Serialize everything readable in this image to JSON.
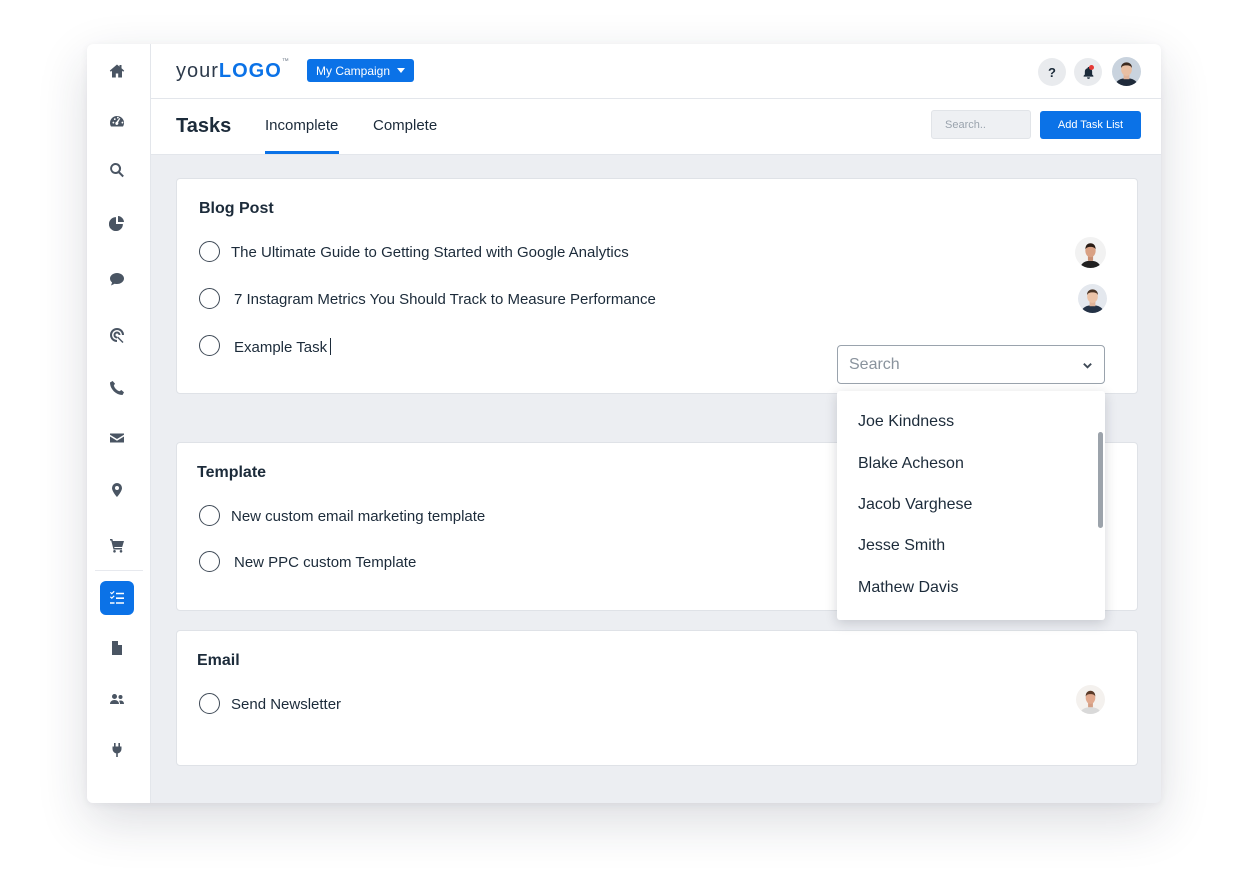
{
  "topbar": {
    "logo_prefix": "your",
    "logo_bold": "LOGO",
    "logo_tm": "™",
    "campaign_label": "My Campaign",
    "help_label": "?"
  },
  "sidebar": {
    "items": [
      {
        "icon": "home-icon"
      },
      {
        "icon": "dashboard-icon"
      },
      {
        "icon": "search-icon"
      },
      {
        "icon": "pie-chart-icon"
      },
      {
        "icon": "chat-icon"
      },
      {
        "icon": "target-icon"
      },
      {
        "icon": "phone-icon"
      },
      {
        "icon": "mail-icon"
      },
      {
        "icon": "location-icon"
      },
      {
        "icon": "cart-icon"
      },
      {
        "icon": "tasks-icon",
        "active": true
      },
      {
        "icon": "document-icon"
      },
      {
        "icon": "users-icon"
      },
      {
        "icon": "plug-icon"
      }
    ]
  },
  "page": {
    "title": "Tasks",
    "tabs": [
      {
        "label": "Incomplete",
        "active": true
      },
      {
        "label": "Complete",
        "active": false
      }
    ],
    "search_placeholder": "Search..",
    "add_button": "Add Task List"
  },
  "task_lists": [
    {
      "title": "Blog Post",
      "tasks": [
        {
          "text": "The Ultimate Guide to Getting Started with Google Analytics"
        },
        {
          "text": "7 Instagram Metrics You Should Track to Measure Performance"
        },
        {
          "text": "Example Task"
        }
      ]
    },
    {
      "title": "Template",
      "tasks": [
        {
          "text": "New custom email marketing template"
        },
        {
          "text": "New PPC custom Template"
        }
      ]
    },
    {
      "title": "Email",
      "tasks": [
        {
          "text": "Send Newsletter"
        }
      ]
    }
  ],
  "assignee_select": {
    "placeholder": "Search",
    "options": [
      "Joe Kindness",
      "Blake Acheson",
      "Jacob Varghese",
      "Jesse Smith",
      "Mathew Davis"
    ]
  },
  "colors": {
    "accent": "#0b72e7",
    "background": "#eceef2",
    "text": "#1c2b3a"
  }
}
